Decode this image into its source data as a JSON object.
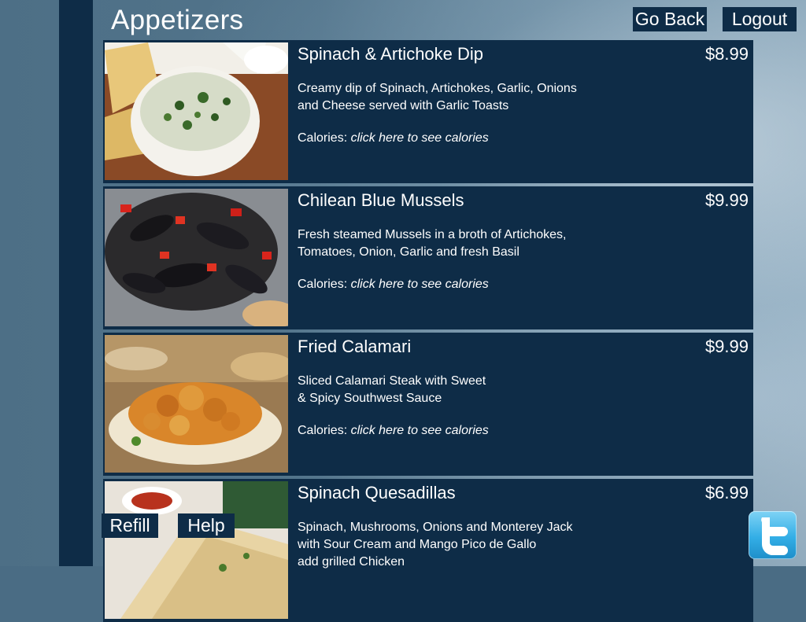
{
  "page": {
    "title": "Appetizers"
  },
  "nav": {
    "go_back": "Go Back",
    "logout": "Logout"
  },
  "footer": {
    "refill": "Refill",
    "help": "Help"
  },
  "menu_items": [
    {
      "name": "Spinach & Artichoke Dip",
      "price": "$8.99",
      "desc_line1": "Creamy dip of Spinach, Artichokes, Garlic, Onions",
      "desc_line2": "and Cheese served with Garlic Toasts",
      "calories_label": "Calories:",
      "calories_link": "click here to see calories"
    },
    {
      "name": "Chilean Blue Mussels",
      "price": "$9.99",
      "desc_line1": "Fresh steamed Mussels in a broth of Artichokes,",
      "desc_line2": "Tomatoes, Onion, Garlic and fresh Basil",
      "calories_label": "Calories:",
      "calories_link": "click here to see calories"
    },
    {
      "name": "Fried Calamari",
      "price": "$9.99",
      "desc_line1": "Sliced Calamari Steak with Sweet",
      "desc_line2": "& Spicy Southwest Sauce",
      "calories_label": "Calories:",
      "calories_link": "click here to see calories"
    },
    {
      "name": "Spinach Quesadillas",
      "price": "$6.99",
      "desc_line1": "Spinach, Mushrooms, Onions and Monterey Jack",
      "desc_line2": "with Sour Cream and Mango Pico de Gallo",
      "desc_line3": "add grilled Chicken"
    }
  ],
  "icons": {
    "social": "twitter-icon"
  },
  "colors": {
    "panel": "#0e2c47",
    "text": "#ffffff",
    "twitter": "#33aee6"
  }
}
